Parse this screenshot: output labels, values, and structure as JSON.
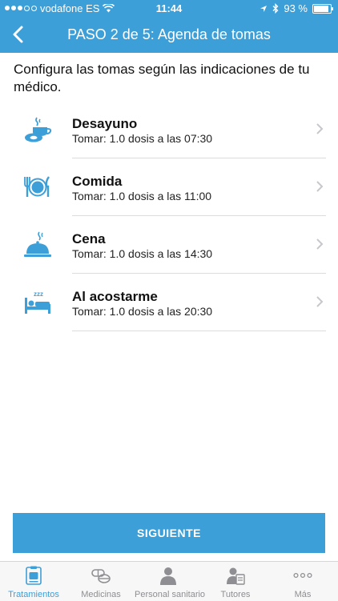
{
  "status_bar": {
    "carrier": "vodafone ES",
    "time": "11:44",
    "battery": "93 %"
  },
  "nav": {
    "title": "PASO 2 de 5: Agenda de tomas"
  },
  "intro": "Configura las tomas según las indicaciones de tu médico.",
  "schedule": [
    {
      "title": "Desayuno",
      "detail": "Tomar: 1.0 dosis a las 07:30",
      "icon": "breakfast-icon"
    },
    {
      "title": "Comida",
      "detail": "Tomar: 1.0 dosis a las 11:00",
      "icon": "lunch-icon"
    },
    {
      "title": "Cena",
      "detail": "Tomar: 1.0 dosis a las 14:30",
      "icon": "dinner-icon"
    },
    {
      "title": "Al acostarme",
      "detail": "Tomar: 1.0 dosis a las 20:30",
      "icon": "bed-icon"
    }
  ],
  "next_button": "SIGUIENTE",
  "tabs": [
    {
      "label": "Tratamientos",
      "icon": "treatments-icon",
      "active": true
    },
    {
      "label": "Medicinas",
      "icon": "pills-icon"
    },
    {
      "label": "Personal sanitario",
      "icon": "doctor-icon"
    },
    {
      "label": "Tutores",
      "icon": "tutors-icon"
    },
    {
      "label": "Más",
      "icon": "more-icon"
    }
  ],
  "colors": {
    "accent": "#3d9fd8",
    "tab_inactive": "#8e8e93"
  }
}
